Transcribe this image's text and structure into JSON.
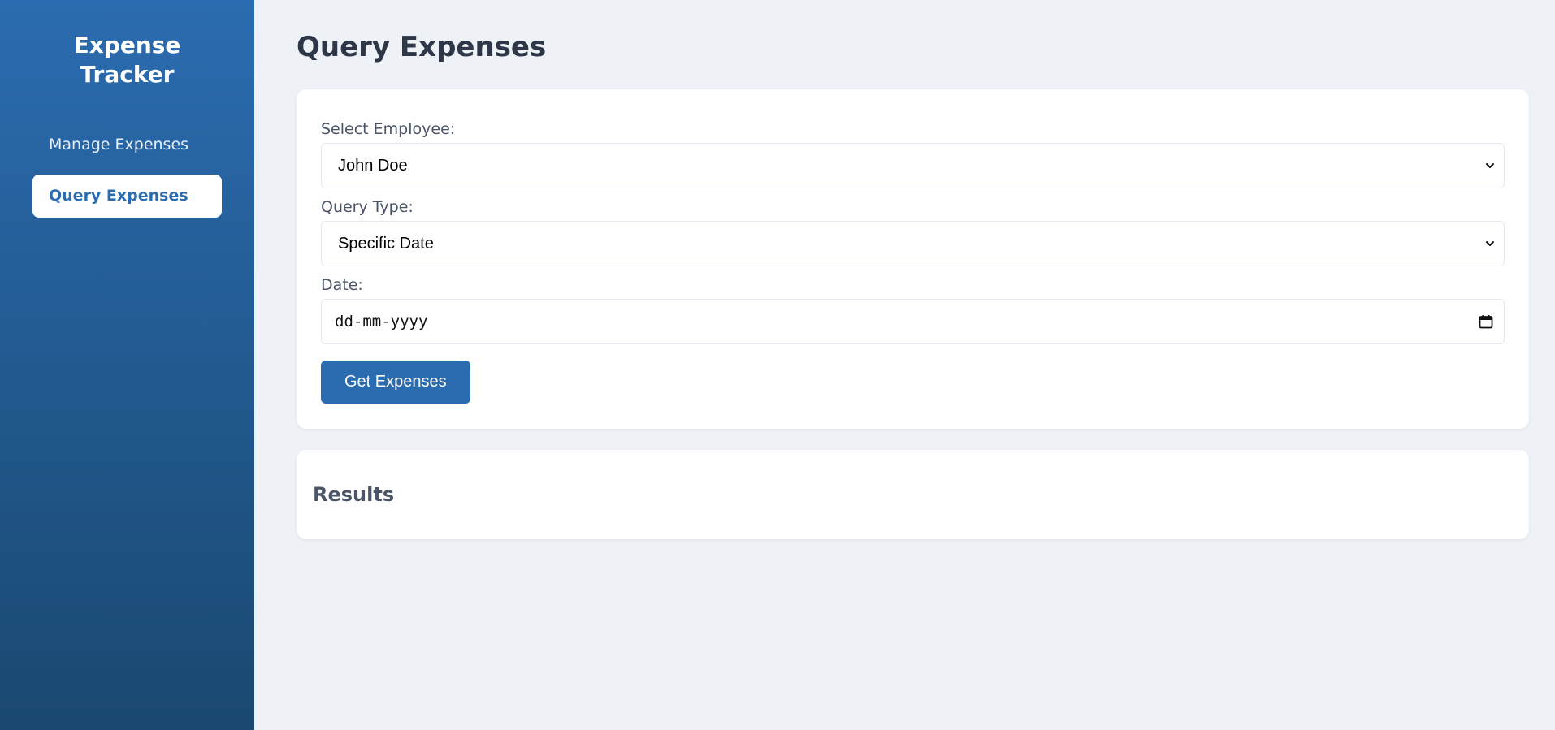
{
  "sidebar": {
    "brand": "Expense Tracker",
    "items": [
      {
        "label": "Manage Expenses",
        "active": false
      },
      {
        "label": "Query Expenses",
        "active": true
      }
    ]
  },
  "main": {
    "title": "Query Expenses",
    "form": {
      "employee_label": "Select Employee:",
      "employee_value": "John Doe",
      "query_type_label": "Query Type:",
      "query_type_value": "Specific Date",
      "date_label": "Date:",
      "date_placeholder": "dd-mm-yyyy",
      "submit_label": "Get Expenses"
    },
    "results": {
      "title": "Results"
    }
  },
  "colors": {
    "sidebar_top": "#2b6cb0",
    "sidebar_bottom": "#1a4870",
    "accent": "#2b6cb0",
    "background": "#eef2f7"
  },
  "icons": {
    "select_arrow": "chevron-down-icon",
    "date_picker": "calendar-icon"
  }
}
